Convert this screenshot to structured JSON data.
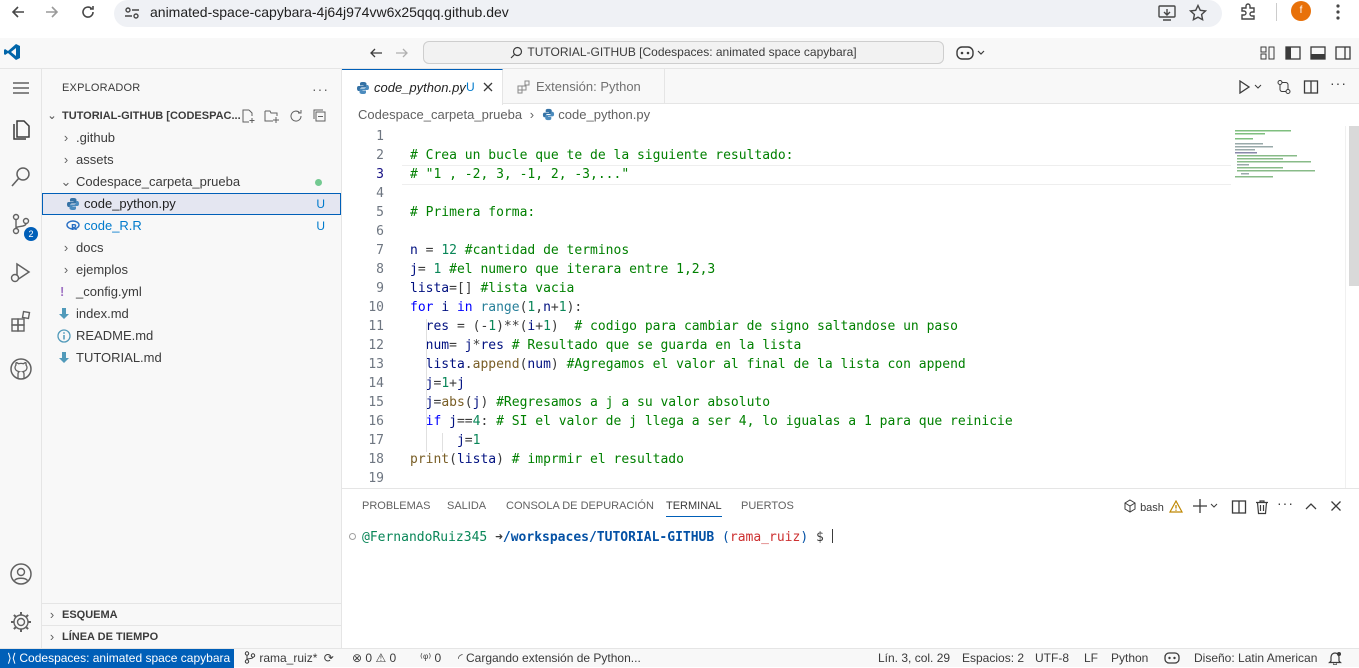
{
  "browser": {
    "url": "animated-space-capybara-4j64j974vw6x25qqq.github.dev",
    "profile_initial": "f"
  },
  "titlebar": {
    "command_center": "TUTORIAL-GITHUB [Codespaces: animated space capybara]"
  },
  "activity": {
    "source_control_badge": "2"
  },
  "sidebar": {
    "title": "EXPLORADOR",
    "root": "TUTORIAL-GITHUB [CODESPAC...",
    "items": [
      {
        "label": ".github",
        "type": "folder"
      },
      {
        "label": "assets",
        "type": "folder"
      },
      {
        "label": "Codespace_carpeta_prueba",
        "type": "folder-open"
      },
      {
        "label": "code_python.py",
        "status": "U"
      },
      {
        "label": "code_R.R",
        "status": "U"
      },
      {
        "label": "docs",
        "type": "folder"
      },
      {
        "label": "ejemplos",
        "type": "folder"
      },
      {
        "label": "_config.yml"
      },
      {
        "label": "index.md"
      },
      {
        "label": "README.md"
      },
      {
        "label": "TUTORIAL.md"
      }
    ],
    "outline": "ESQUEMA",
    "timeline": "LÍNEA DE TIEMPO"
  },
  "tabs": [
    {
      "label": "code_python.py",
      "status": "U"
    },
    {
      "label": "Extensión: Python"
    }
  ],
  "breadcrumb": {
    "folder": "Codespace_carpeta_prueba",
    "file": "code_python.py"
  },
  "editor": {
    "line_numbers": [
      "1",
      "2",
      "3",
      "4",
      "5",
      "6",
      "7",
      "8",
      "9",
      "10",
      "11",
      "12",
      "13",
      "14",
      "15",
      "16",
      "17",
      "18",
      "19"
    ]
  },
  "panel": {
    "tabs": [
      "PROBLEMAS",
      "SALIDA",
      "CONSOLA DE DEPURACIÓN",
      "TERMINAL",
      "PUERTOS"
    ],
    "shell": "bash",
    "user": "@FernandoRuiz345",
    "path": "/workspaces/TUTORIAL-GITHUB",
    "branch": "rama_ruiz"
  },
  "status": {
    "remote": "Codespaces: animated space capybara",
    "branch": "rama_ruiz*",
    "errors": "0",
    "warnings": "0",
    "ports": "0",
    "loading": "Cargando extensión de Python...",
    "position": "Lín. 3, col. 29",
    "spaces": "Espacios: 2",
    "encoding": "UTF-8",
    "eol": "LF",
    "language": "Python",
    "keyboard": "Diseño: Latin American"
  },
  "colors": {
    "accent": "#005fb8",
    "comment": "#008000",
    "keyword": "#0000ff",
    "number": "#098658"
  }
}
